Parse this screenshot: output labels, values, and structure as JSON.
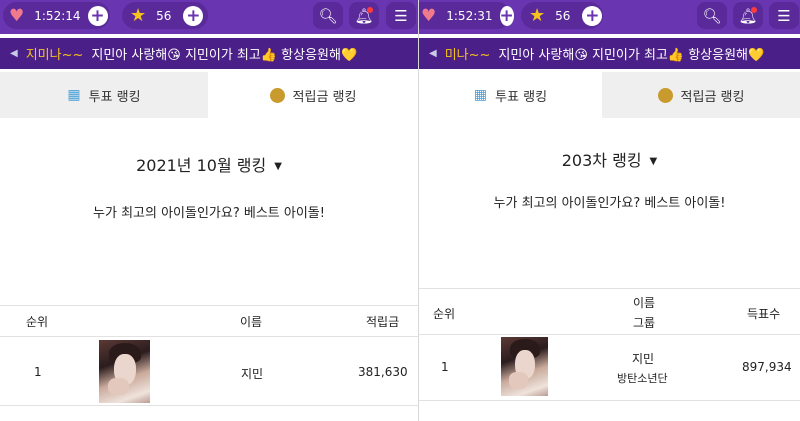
{
  "left": {
    "status": {
      "time": "1:52:14",
      "stars": "56"
    },
    "marquee": {
      "highlight": "지미나~~",
      "message": "지민아 사랑해😘 지민이가 최고👍 항상응원해💛"
    },
    "tabs": {
      "vote_ranking": "투표 랭킹",
      "points_ranking": "적립금 랭킹"
    },
    "heading": "2021년 10월 랭킹",
    "subtitle": "누가 최고의 아이돌인가요? 베스트 아이돌!",
    "table": {
      "col_rank": "순위",
      "col_name": "이름",
      "col_value": "적립금",
      "rows": [
        {
          "rank": "1",
          "name": "지민",
          "value": "381,630"
        }
      ]
    }
  },
  "right": {
    "status": {
      "time": "1:52:31",
      "stars": "56"
    },
    "marquee": {
      "highlight": "미나~~",
      "message": "지민아 사랑해😘 지민이가 최고👍 항상응원해💛"
    },
    "tabs": {
      "vote_ranking": "투표 랭킹",
      "points_ranking": "적립금 랭킹"
    },
    "heading": "203차 랭킹",
    "subtitle": "누가 최고의 아이돌인가요? 베스트 아이돌!",
    "table": {
      "col_rank": "순위",
      "col_name": "이름",
      "col_group": "그룹",
      "col_value": "득표수",
      "rows": [
        {
          "rank": "1",
          "name": "지민",
          "group": "방탄소년단",
          "value": "897,934"
        }
      ]
    }
  },
  "icons": {
    "heart": "heart-icon",
    "star": "star-icon",
    "plus": "plus-icon",
    "search": "search-icon",
    "bell": "bell-icon",
    "menu": "menu-icon",
    "megaphone": "megaphone-icon",
    "ticket": "ticket-icon",
    "coin": "coin-icon",
    "caret": "caret-down-icon"
  },
  "colors": {
    "topbar": "#6a35b0",
    "pill": "#5a2a9a",
    "marquee": "#4b1f88",
    "highlight": "#f6c21c",
    "heart": "#f07a8c",
    "notification_dot": "#ff3b3b",
    "inactive_tab": "#efefef"
  }
}
